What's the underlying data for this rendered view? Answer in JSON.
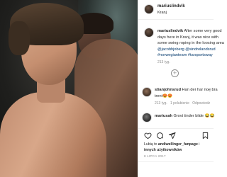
{
  "post": {
    "author": "mariuslindvik",
    "location": "Kranj"
  },
  "caption": {
    "author": "mariuslindvik",
    "text_line1": "After some very good",
    "text_line2": "days here in Kranj, it was nice with",
    "text_line3": "some swing roping in the loosing area",
    "mention": "@jacobhjoberg @sindrelandsrud",
    "hashtag": "#norwegianteam #tarsportsway",
    "time": "213 tyg."
  },
  "comments": [
    {
      "author": "stianjohnsrud",
      "text_line1": "Han der har noe bra",
      "text_line2": "trent😍😍",
      "time": "213 tyg.",
      "likes": "1 polubienie",
      "reply": "Odpowiedz"
    },
    {
      "author": "mariusah",
      "text": "Grovt tinder bilde 😂😂"
    }
  ],
  "likes_line1": "Lubią to",
  "likes_user": "andiwellinger_fanpage",
  "likes_line1_tail": " i",
  "likes_line2": "innych użytkowników",
  "date": "8 LIPCA 2017",
  "colors": {
    "text": "#262626",
    "secondary": "#8e8e8e",
    "link": "#00376b",
    "border": "#efefef"
  }
}
